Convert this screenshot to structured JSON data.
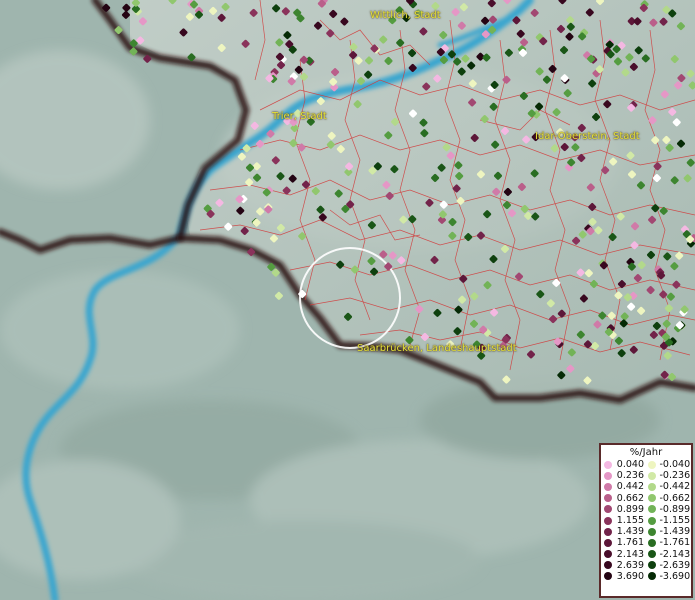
{
  "map": {
    "places": [
      {
        "name": "Wittlich, Stadt"
      },
      {
        "name": "Trier, Stadt"
      },
      {
        "name": "Idar-Oberstein, Stadt"
      },
      {
        "name": "Saarbrücken, Landeshauptstadt"
      }
    ],
    "colors": {
      "terrain": "#9fb5ae",
      "border": "#2a0f0f",
      "river": "#3aa6cf",
      "municipality_lines": "#d23a3a",
      "label_text": "#e6e23a"
    },
    "legend": {
      "title": "%/Jahr",
      "positive": [
        {
          "value": "0.040",
          "color": "#f4b8e2"
        },
        {
          "value": "0.236",
          "color": "#e597c6"
        },
        {
          "value": "0.442",
          "color": "#d07aa8"
        },
        {
          "value": "0.662",
          "color": "#ba5f8a"
        },
        {
          "value": "0.899",
          "color": "#a24872"
        },
        {
          "value": "1.155",
          "color": "#8a335b"
        },
        {
          "value": "1.439",
          "color": "#72234a"
        },
        {
          "value": "1.761",
          "color": "#5d1739"
        },
        {
          "value": "2.143",
          "color": "#4a0e2b"
        },
        {
          "value": "2.639",
          "color": "#38081f"
        },
        {
          "value": "3.690",
          "color": "#240413"
        }
      ],
      "negative": [
        {
          "value": "-0.040",
          "color": "#eef5c0"
        },
        {
          "value": "-0.236",
          "color": "#d1e9a6"
        },
        {
          "value": "-0.442",
          "color": "#b2d98a"
        },
        {
          "value": "-0.662",
          "color": "#91c76e"
        },
        {
          "value": "-0.899",
          "color": "#72b357"
        },
        {
          "value": "-1.155",
          "color": "#559d41"
        },
        {
          "value": "-1.439",
          "color": "#3d8530"
        },
        {
          "value": "-1.761",
          "color": "#296d22"
        },
        {
          "value": "-2.143",
          "color": "#1a5617"
        },
        {
          "value": "-2.639",
          "color": "#0e400e"
        },
        {
          "value": "-3.690",
          "color": "#052a05"
        }
      ]
    }
  }
}
